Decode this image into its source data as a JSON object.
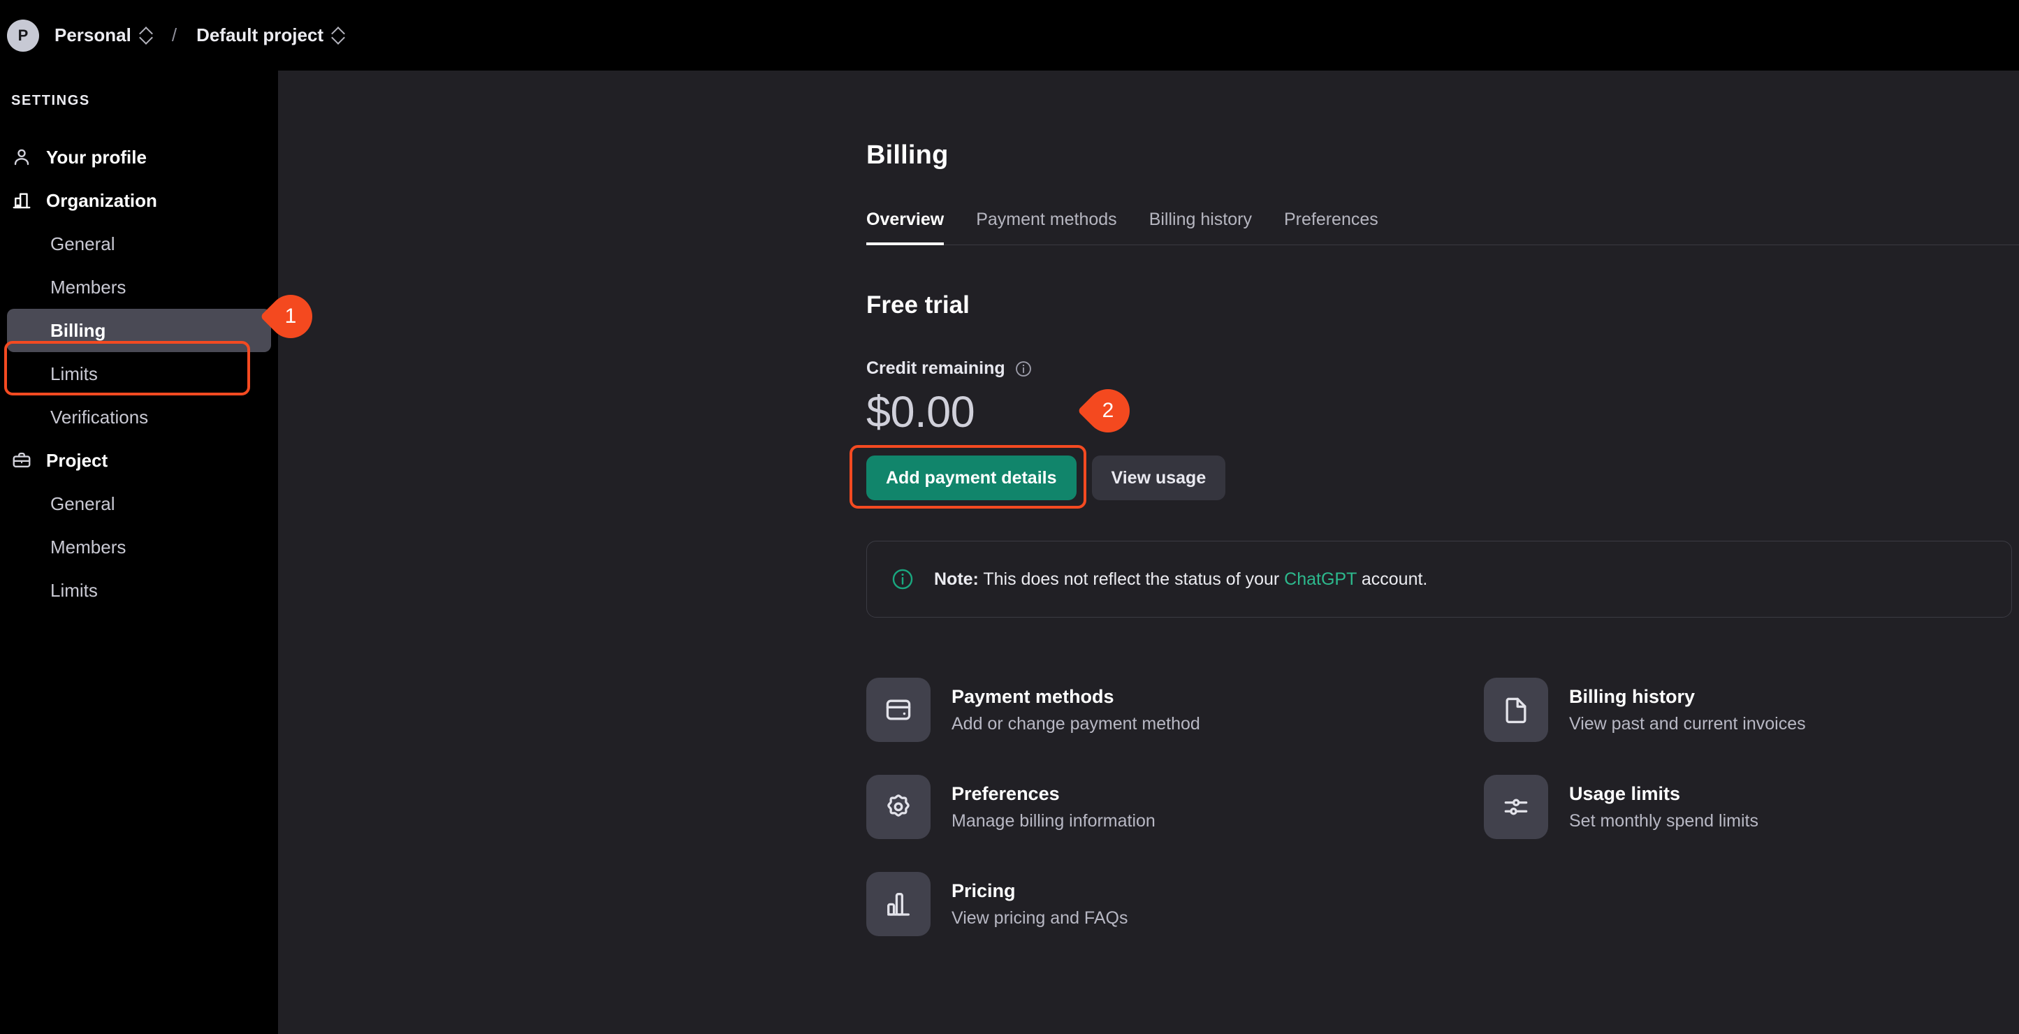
{
  "topbar": {
    "avatar_initial": "P",
    "org_name": "Personal",
    "separator": "/",
    "project_name": "Default project"
  },
  "sidebar": {
    "section_title": "SETTINGS",
    "items": [
      {
        "label": "Your profile",
        "icon": "user-icon",
        "type": "head",
        "active": false
      },
      {
        "label": "Organization",
        "icon": "building-icon",
        "type": "head",
        "active": false
      },
      {
        "label": "General",
        "icon": "",
        "type": "sub",
        "active": false
      },
      {
        "label": "Members",
        "icon": "",
        "type": "sub",
        "active": false
      },
      {
        "label": "Billing",
        "icon": "",
        "type": "sub",
        "active": true
      },
      {
        "label": "Limits",
        "icon": "",
        "type": "sub",
        "active": false
      },
      {
        "label": "Verifications",
        "icon": "",
        "type": "sub",
        "active": false
      },
      {
        "label": "Project",
        "icon": "briefcase-icon",
        "type": "head",
        "active": false
      },
      {
        "label": "General",
        "icon": "",
        "type": "sub",
        "active": false
      },
      {
        "label": "Members",
        "icon": "",
        "type": "sub",
        "active": false
      },
      {
        "label": "Limits",
        "icon": "",
        "type": "sub",
        "active": false
      }
    ]
  },
  "main": {
    "page_title": "Billing",
    "tabs": [
      {
        "label": "Overview",
        "active": true
      },
      {
        "label": "Payment methods",
        "active": false
      },
      {
        "label": "Billing history",
        "active": false
      },
      {
        "label": "Preferences",
        "active": false
      }
    ],
    "section_title": "Free trial",
    "credit_label": "Credit remaining",
    "credit_amount": "$0.00",
    "primary_button": "Add payment details",
    "secondary_button": "View usage",
    "note": {
      "bold": "Note:",
      "text_before": " This does not reflect the status of your ",
      "link": "ChatGPT",
      "text_after": " account."
    },
    "cards": [
      {
        "title": "Payment methods",
        "subtitle": "Add or change payment method",
        "icon": "credit-card-icon"
      },
      {
        "title": "Billing history",
        "subtitle": "View past and current invoices",
        "icon": "document-icon"
      },
      {
        "title": "Preferences",
        "subtitle": "Manage billing information",
        "icon": "gear-icon"
      },
      {
        "title": "Usage limits",
        "subtitle": "Set monthly spend limits",
        "icon": "sliders-icon"
      },
      {
        "title": "Pricing",
        "subtitle": "View pricing and FAQs",
        "icon": "bar-chart-icon"
      }
    ]
  },
  "annotations": {
    "badges": [
      {
        "number": "1"
      },
      {
        "number": "2"
      }
    ],
    "accent_color": "#f4491f",
    "primary_color": "#11856b",
    "link_color": "#2db98d"
  }
}
